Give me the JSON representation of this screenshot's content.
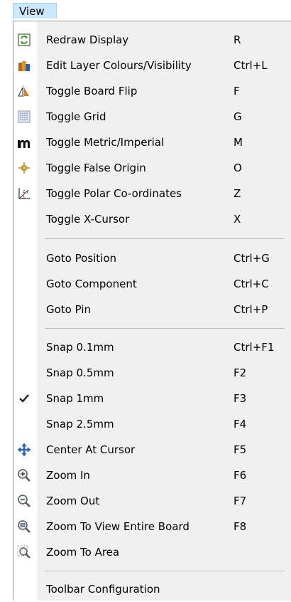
{
  "menubar": {
    "title": "View"
  },
  "menu": {
    "items": [
      {
        "label": "Redraw Display",
        "shortcut": "R",
        "icon": "redraw-icon"
      },
      {
        "label": "Edit Layer Colours/Visibility",
        "shortcut": "Ctrl+L",
        "icon": "layers-icon"
      },
      {
        "label": "Toggle Board Flip",
        "shortcut": "F",
        "icon": "board-flip-icon"
      },
      {
        "label": "Toggle Grid",
        "shortcut": "G",
        "icon": "grid-icon"
      },
      {
        "label": "Toggle Metric/Imperial",
        "shortcut": "M",
        "icon": "metric-m-icon"
      },
      {
        "label": "Toggle False Origin",
        "shortcut": "O",
        "icon": "false-origin-icon"
      },
      {
        "label": "Toggle Polar Co-ordinates",
        "shortcut": "Z",
        "icon": "polar-coordinates-icon"
      },
      {
        "label": "Toggle X-Cursor",
        "shortcut": "X"
      },
      {
        "label": "Goto Position",
        "shortcut": "Ctrl+G"
      },
      {
        "label": "Goto Component",
        "shortcut": "Ctrl+C"
      },
      {
        "label": "Goto Pin",
        "shortcut": "Ctrl+P"
      },
      {
        "label": "Snap 0.1mm",
        "shortcut": "Ctrl+F1"
      },
      {
        "label": "Snap 0.5mm",
        "shortcut": "F2"
      },
      {
        "label": "Snap 1mm",
        "shortcut": "F3",
        "checked": true
      },
      {
        "label": "Snap 2.5mm",
        "shortcut": "F4"
      },
      {
        "label": "Center At Cursor",
        "shortcut": "F5",
        "icon": "move-arrows-icon"
      },
      {
        "label": "Zoom In",
        "shortcut": "F6",
        "icon": "zoom-in-icon"
      },
      {
        "label": "Zoom Out",
        "shortcut": "F7",
        "icon": "zoom-out-icon"
      },
      {
        "label": "Zoom To View Entire Board",
        "shortcut": "F8",
        "icon": "zoom-board-icon"
      },
      {
        "label": "Zoom To Area",
        "shortcut": "",
        "icon": "zoom-area-icon"
      },
      {
        "label": "Toolbar Configuration",
        "shortcut": ""
      }
    ]
  }
}
